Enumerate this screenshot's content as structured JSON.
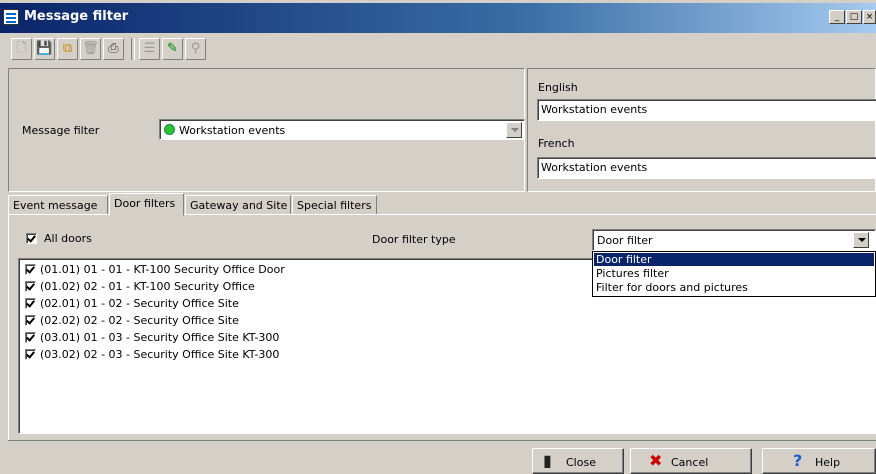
{
  "window": {
    "title": "Message filter",
    "controls": [
      "_",
      "□",
      "×"
    ]
  },
  "toolbar": {
    "icons": [
      {
        "name": "new-icon",
        "glyph": "🗋",
        "enabled": false
      },
      {
        "name": "save-icon",
        "glyph": "💾",
        "enabled": true
      },
      {
        "name": "copy-icon",
        "glyph": "⧉",
        "enabled": true
      },
      {
        "name": "delete-icon",
        "glyph": "🗑",
        "enabled": false
      },
      {
        "name": "print-icon",
        "glyph": "⎙",
        "enabled": true
      },
      {
        "name": "list-icon",
        "glyph": "☰",
        "enabled": false
      },
      {
        "name": "link-icon",
        "glyph": "✎",
        "enabled": true
      },
      {
        "name": "binoculars-icon",
        "glyph": "⚲",
        "enabled": false
      }
    ]
  },
  "filter": {
    "label": "Message filter",
    "selected": "Workstation events"
  },
  "languages": {
    "english_label": "English",
    "english_value": "Workstation events",
    "french_label": "French",
    "french_value": "Workstation events"
  },
  "tabs": [
    "Event message",
    "Door filters",
    "Gateway and Site",
    "Special filters"
  ],
  "door_filters": {
    "all_doors_label": "All doors",
    "all_doors_checked": true,
    "filter_type_label": "Door filter type",
    "filter_type_value": "Door filter",
    "filter_type_options": [
      "Door filter",
      "Pictures filter",
      "Filter for doors and pictures"
    ],
    "doors": [
      "(01.01) 01 - 01 - KT-100 Security Office Door",
      "(01.02) 02 - 01 - KT-100 Security Office",
      "(02.01) 01 - 02 - Security Office Site",
      "(02.02) 02 - 02 - Security Office Site",
      "(03.01) 01 - 03 - Security Office Site KT-300",
      "(03.02) 02 - 03 - Security Office Site KT-300"
    ]
  },
  "buttons": {
    "close": "Close",
    "cancel": "Cancel",
    "help": "Help"
  },
  "colors": {
    "titlebar": "#0a246a",
    "status_dot": "#2ec42e",
    "cancel_icon": "#cc0000",
    "help_icon": "#1a5fd0"
  }
}
